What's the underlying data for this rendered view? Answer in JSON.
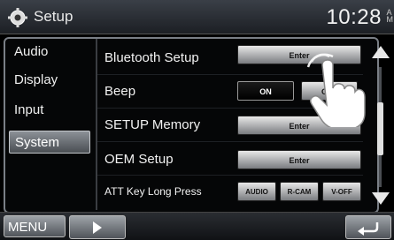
{
  "header": {
    "title": "Setup",
    "time": "10:28",
    "ampm_top": "A",
    "ampm_bottom": "M"
  },
  "sidebar": {
    "items": [
      {
        "label": "Audio",
        "active": false
      },
      {
        "label": "Display",
        "active": false
      },
      {
        "label": "Input",
        "active": false
      },
      {
        "label": "System",
        "active": true
      }
    ]
  },
  "rows": [
    {
      "label": "Bluetooth Setup",
      "button": "Enter"
    },
    {
      "label": "Beep",
      "options": [
        "ON",
        "OFF"
      ]
    },
    {
      "label": "SETUP Memory",
      "button": "Enter"
    },
    {
      "label": "OEM Setup",
      "button": "Enter"
    },
    {
      "label": "ATT Key Long Press",
      "options": [
        "AUDIO",
        "R-CAM",
        "V-OFF"
      ]
    }
  ],
  "footer": {
    "menu_label": "MENU"
  },
  "icons": {
    "settings": "gear-icon",
    "next": "chevron-right-icon",
    "back": "return-arrow-icon",
    "touch": "pointing-hand-icon"
  }
}
